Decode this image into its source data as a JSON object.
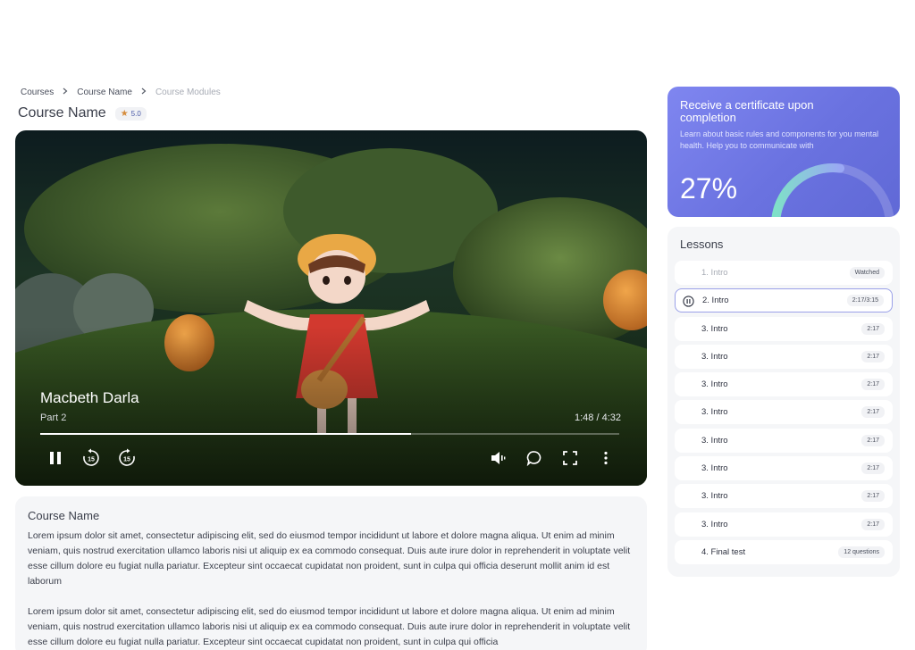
{
  "breadcrumb": {
    "items": [
      "Courses",
      "Course Name"
    ],
    "current": "Course Modules"
  },
  "page": {
    "title": "Course Name",
    "rating": "5.0"
  },
  "video": {
    "title": "Macbeth Darla",
    "subtitle": "Part 2",
    "time": "1:48 / 4:32",
    "progress": 0.64
  },
  "description": {
    "title": "Course Name",
    "paragraphs": [
      "Lorem ipsum dolor sit amet, consectetur adipiscing elit, sed do eiusmod tempor incididunt ut labore et dolore magna aliqua. Ut enim ad minim veniam, quis nostrud exercitation ullamco laboris nisi ut aliquip ex ea commodo consequat. Duis aute irure dolor in reprehenderit in voluptate velit esse cillum dolore eu fugiat nulla pariatur. Excepteur sint occaecat cupidatat non proident, sunt in culpa qui officia deserunt mollit anim id est laborum",
      "Lorem ipsum dolor sit amet, consectetur adipiscing elit, sed do eiusmod tempor incididunt ut labore et dolore magna aliqua. Ut enim ad minim veniam, quis nostrud exercitation ullamco laboris nisi ut aliquip ex ea commodo consequat. Duis aute irure dolor in reprehenderit in voluptate velit esse cillum dolore eu fugiat nulla pariatur. Excepteur sint occaecat cupidatat non proident, sunt in culpa qui officia"
    ]
  },
  "certificate": {
    "title": "Receive a certificate upon completion",
    "text": "Learn about basic rules and components for you mental health. Help you to communicate with",
    "percent_label": "27%",
    "progress": 0.27
  },
  "lessons": {
    "title": "Lessons",
    "items": [
      {
        "label": "1. Intro",
        "badge": "Watched",
        "state": "watched"
      },
      {
        "label": "2. Intro",
        "badge": "2:17/3:15",
        "state": "active"
      },
      {
        "label": "3. Intro",
        "badge": "2:17",
        "state": "normal"
      },
      {
        "label": "3. Intro",
        "badge": "2:17",
        "state": "normal"
      },
      {
        "label": "3. Intro",
        "badge": "2:17",
        "state": "normal"
      },
      {
        "label": "3. Intro",
        "badge": "2:17",
        "state": "normal"
      },
      {
        "label": "3. Intro",
        "badge": "2:17",
        "state": "normal"
      },
      {
        "label": "3. Intro",
        "badge": "2:17",
        "state": "normal"
      },
      {
        "label": "3. Intro",
        "badge": "2:17",
        "state": "normal"
      },
      {
        "label": "3. Intro",
        "badge": "2:17",
        "state": "normal"
      },
      {
        "label": "4. Final test",
        "badge": "12 questions",
        "state": "normal"
      }
    ]
  },
  "colors": {
    "accent": "#6a72e0",
    "active_border": "#9aa0e8",
    "star": "#d58b3a"
  },
  "icons": [
    "chevron-right-icon",
    "star-icon",
    "pause-icon",
    "replay-15-icon",
    "forward-15-icon",
    "volume-icon",
    "chat-icon",
    "fullscreen-icon",
    "more-vertical-icon"
  ]
}
